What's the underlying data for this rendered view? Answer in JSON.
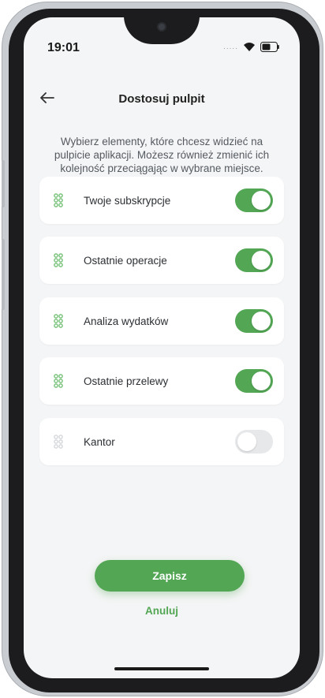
{
  "status_bar": {
    "time": "19:01",
    "dots": "....."
  },
  "header": {
    "title": "Dostosuj pulpit"
  },
  "description": "Wybierz elementy, które chcesz widzieć na pulpicie aplikacji. Możesz również zmienić ich kolejność przeciągając w wybrane miejsce.",
  "items": [
    {
      "label": "Twoje subskrypcje",
      "enabled": true
    },
    {
      "label": "Ostatnie operacje",
      "enabled": true
    },
    {
      "label": "Analiza wydatków",
      "enabled": true
    },
    {
      "label": "Ostatnie przelewy",
      "enabled": true
    },
    {
      "label": "Kantor",
      "enabled": false
    }
  ],
  "actions": {
    "save_label": "Zapisz",
    "cancel_label": "Anuluj"
  },
  "colors": {
    "accent": "#52a654",
    "drag_active": "#7cc47e",
    "drag_inactive": "#d7dadd",
    "background": "#f4f5f6"
  },
  "icons": {
    "back": "arrow-left-icon",
    "drag": "drag-handle-icon",
    "wifi": "wifi-icon",
    "battery": "battery-icon"
  }
}
